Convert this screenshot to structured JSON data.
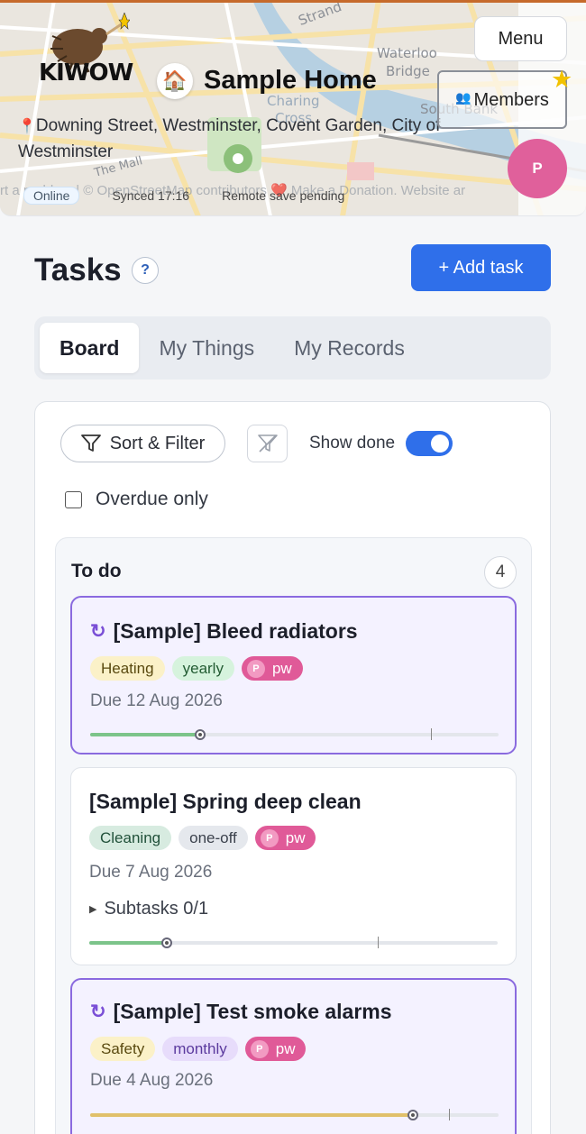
{
  "header": {
    "logo_text": "KIWOW",
    "home_icon": "house-emoji",
    "home_title": "Sample Home",
    "address": "Downing Street, Westminster, Covent Garden, City of Westminster",
    "menu_label": "Menu",
    "members_label": "Members",
    "avatar_initial": "P",
    "map_attribution": "rt a problem | © OpenStreetMap contributors ❤️ Make a Donation. Website ar",
    "status": {
      "online": "Online",
      "synced": "Synced 17:16",
      "pending": "Remote save pending"
    },
    "map_labels": [
      "Strand",
      "Waterloo",
      "Bridge",
      "South Bank",
      "Charing",
      "Cross",
      "The Mall"
    ]
  },
  "tasks": {
    "title": "Tasks",
    "help": "?",
    "add_label": "+ Add task",
    "tabs": [
      {
        "label": "Board",
        "active": true
      },
      {
        "label": "My Things",
        "active": false
      },
      {
        "label": "My Records",
        "active": false
      }
    ],
    "filters": {
      "sort_label": "Sort & Filter",
      "show_done_label": "Show done",
      "show_done": true,
      "overdue_label": "Overdue only",
      "overdue_checked": false
    },
    "column": {
      "title": "To do",
      "count": "4",
      "cards": [
        {
          "title": "[Sample] Bleed radiators",
          "recurring": true,
          "tags": [
            {
              "label": "Heating",
              "kind": "heating"
            },
            {
              "label": "yearly",
              "kind": "yearly"
            }
          ],
          "assignee": {
            "initial": "P",
            "name": "pw"
          },
          "due": "Due 12 Aug 2026",
          "progress": 0.27,
          "progress_color": "#7cc48a"
        },
        {
          "title": "[Sample] Spring deep clean",
          "recurring": false,
          "tags": [
            {
              "label": "Cleaning",
              "kind": "cleaning"
            },
            {
              "label": "one-off",
              "kind": "oneoff"
            }
          ],
          "assignee": {
            "initial": "P",
            "name": "pw"
          },
          "due": "Due 7 Aug 2026",
          "subtasks": "Subtasks 0/1",
          "progress": 0.19,
          "progress_color": "#7cc48a"
        },
        {
          "title": "[Sample] Test smoke alarms",
          "recurring": true,
          "tags": [
            {
              "label": "Safety",
              "kind": "safety"
            },
            {
              "label": "monthly",
              "kind": "monthly"
            }
          ],
          "assignee": {
            "initial": "P",
            "name": "pw"
          },
          "due": "Due 4 Aug 2026",
          "progress": 0.79,
          "progress_color": "#e0c06a"
        }
      ]
    }
  },
  "colors": {
    "accent": "#2f6fea",
    "avatar": "#e0609b",
    "recurring": "#8a6adf"
  }
}
